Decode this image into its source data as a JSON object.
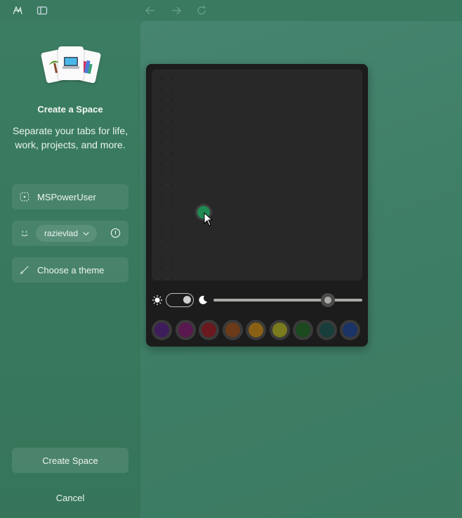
{
  "titlebar": {
    "icons": [
      "spaces-logo-icon",
      "sidebar-toggle-icon",
      "back-arrow-icon",
      "forward-arrow-icon",
      "refresh-icon"
    ]
  },
  "panel": {
    "hero_icons": [
      "palm-tree-icon",
      "laptop-icon",
      "books-icon"
    ],
    "title": "Create a Space",
    "subtitle": "Separate your tabs for life, work, projects, and more.",
    "name_field": {
      "value": "MSPowerUser",
      "icon": "space-icon"
    },
    "profile": {
      "icon": "smiley-icon",
      "selected": "razievlad",
      "info_icon": "info-icon"
    },
    "theme_button": {
      "label": "Choose a theme",
      "icon": "brush-icon"
    },
    "create_button": "Create Space",
    "cancel_button": "Cancel"
  },
  "theme_picker": {
    "selected_color": "#1f8a52",
    "dark_mode": true,
    "intensity": 0.77,
    "swatches": [
      {
        "name": "purple",
        "color": "#3f1d5c"
      },
      {
        "name": "magenta",
        "color": "#5a1850"
      },
      {
        "name": "red",
        "color": "#6a1a1e"
      },
      {
        "name": "orange",
        "color": "#6b3a18"
      },
      {
        "name": "amber",
        "color": "#8a6114"
      },
      {
        "name": "olive",
        "color": "#7a7a1e"
      },
      {
        "name": "green",
        "color": "#1b4a1f"
      },
      {
        "name": "teal",
        "color": "#173e3a"
      },
      {
        "name": "blue",
        "color": "#1a3466"
      }
    ]
  }
}
